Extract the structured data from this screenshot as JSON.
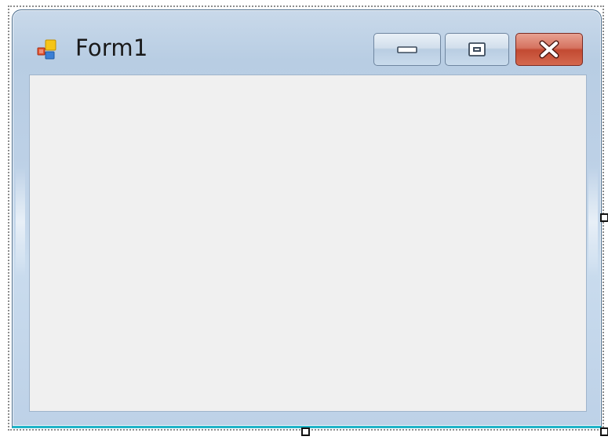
{
  "window": {
    "title": "Form1",
    "icon": "form-app-icon"
  },
  "caption_buttons": {
    "minimize_icon": "minimize-icon",
    "maximize_icon": "maximize-icon",
    "close_icon": "close-icon"
  },
  "colors": {
    "frame": "#bcd0e6",
    "client": "#f0f0f0",
    "close_button": "#c24a32",
    "bottom_edge": "#1fb4c8"
  }
}
